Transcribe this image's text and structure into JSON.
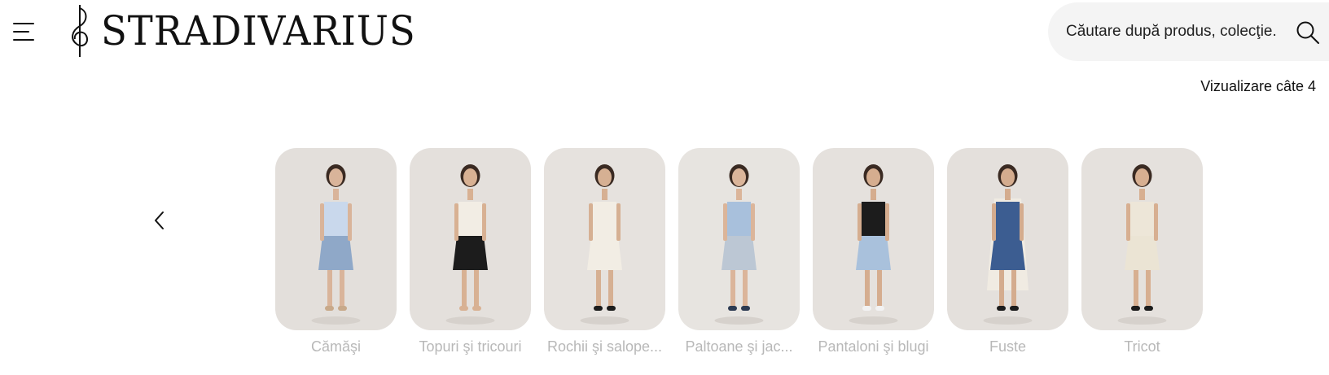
{
  "header": {
    "menu_icon": "hamburger-menu-icon",
    "logo_text": "STRADIVARIUS",
    "logo_icon": "treble-clef-icon",
    "search": {
      "placeholder": "Căutare după produs, colecţie...",
      "icon": "search-icon"
    }
  },
  "toolbar": {
    "view_label": "Vizualizare câte 4"
  },
  "carousel": {
    "prev_icon": "chevron-left-icon",
    "categories": [
      {
        "label": "Cămăşi",
        "bg": "#e3dfdb",
        "top": "#c9d8ec",
        "bottom": "#8fa8c8",
        "skin": "#d9b49a",
        "shoes": "#c8a98a"
      },
      {
        "label": "Topuri şi tricouri",
        "bg": "#e4e0dc",
        "top": "#f2ede4",
        "bottom": "#1c1c1c",
        "skin": "#d8b193",
        "shoes": "#d8b193"
      },
      {
        "label": "Rochii şi salope...",
        "bg": "#e6e2de",
        "top": "#f2ede4",
        "bottom": "#f2ede4",
        "skin": "#d6b093",
        "shoes": "#1c1c1c"
      },
      {
        "label": "Paltoane şi jac...",
        "bg": "#e7e4e0",
        "top": "#a8c0dc",
        "bottom": "#bcc7d4",
        "skin": "#dbb59a",
        "shoes": "#2d3b52"
      },
      {
        "label": "Pantaloni şi blugi",
        "bg": "#e5e1dd",
        "top": "#1c1c1c",
        "bottom": "#a9c1dc",
        "skin": "#d5ad8f",
        "shoes": "#f2f2f2"
      },
      {
        "label": "Fuste",
        "bg": "#e4e0dc",
        "top": "#3c5d91",
        "bottom": "#3c5d91",
        "skin": "#d4ac8e",
        "shoes": "#1c1c1c",
        "coat": "#f0ebe2"
      },
      {
        "label": "Tricot",
        "bg": "#e5e1dd",
        "top": "#ede6d8",
        "bottom": "#ebe4d4",
        "skin": "#d7af91",
        "shoes": "#1c1c1c"
      }
    ]
  }
}
